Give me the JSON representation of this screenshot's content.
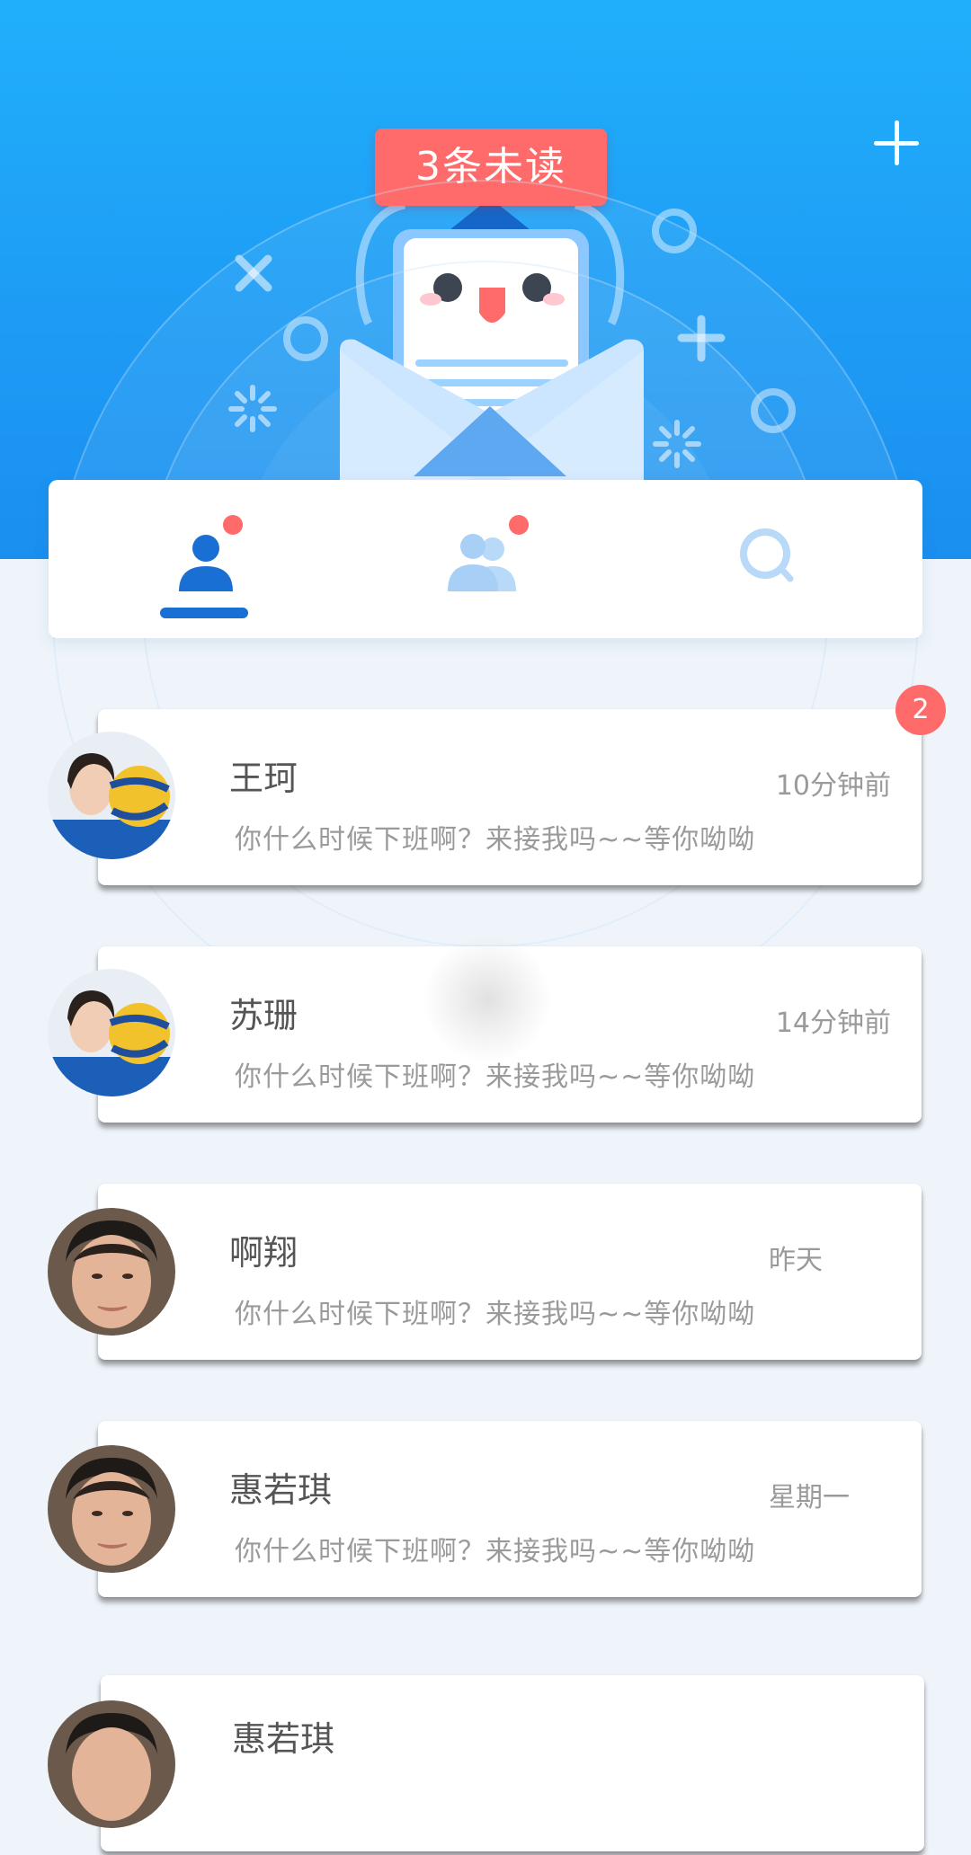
{
  "header": {
    "unread_label": "3条未读",
    "add_icon": "plus-icon",
    "mascot_icon": "mail-mascot-illustration",
    "brand_color": "#1e9cf5",
    "accent_color": "#ff6b6b"
  },
  "tabs": [
    {
      "name": "contacts",
      "icon": "user-icon",
      "active": true,
      "has_dot": true
    },
    {
      "name": "groups",
      "icon": "group-icon",
      "active": false,
      "has_dot": true
    },
    {
      "name": "search",
      "icon": "search-icon",
      "active": false,
      "has_dot": false
    }
  ],
  "conversations": [
    {
      "name": "王珂",
      "time": "10分钟前",
      "message": "你什么时候下班啊？来接我吗~~等你呦呦",
      "unread": "2"
    },
    {
      "name": "苏珊",
      "time": "14分钟前",
      "message": "你什么时候下班啊？来接我吗~~等你呦呦"
    },
    {
      "name": "啊翔",
      "time": "昨天",
      "message": "你什么时候下班啊？来接我吗~~等你呦呦"
    },
    {
      "name": "惠若琪",
      "time": "星期一",
      "message": "你什么时候下班啊？来接我吗~~等你呦呦"
    },
    {
      "name": "惠若琪",
      "time": "",
      "message": ""
    }
  ]
}
